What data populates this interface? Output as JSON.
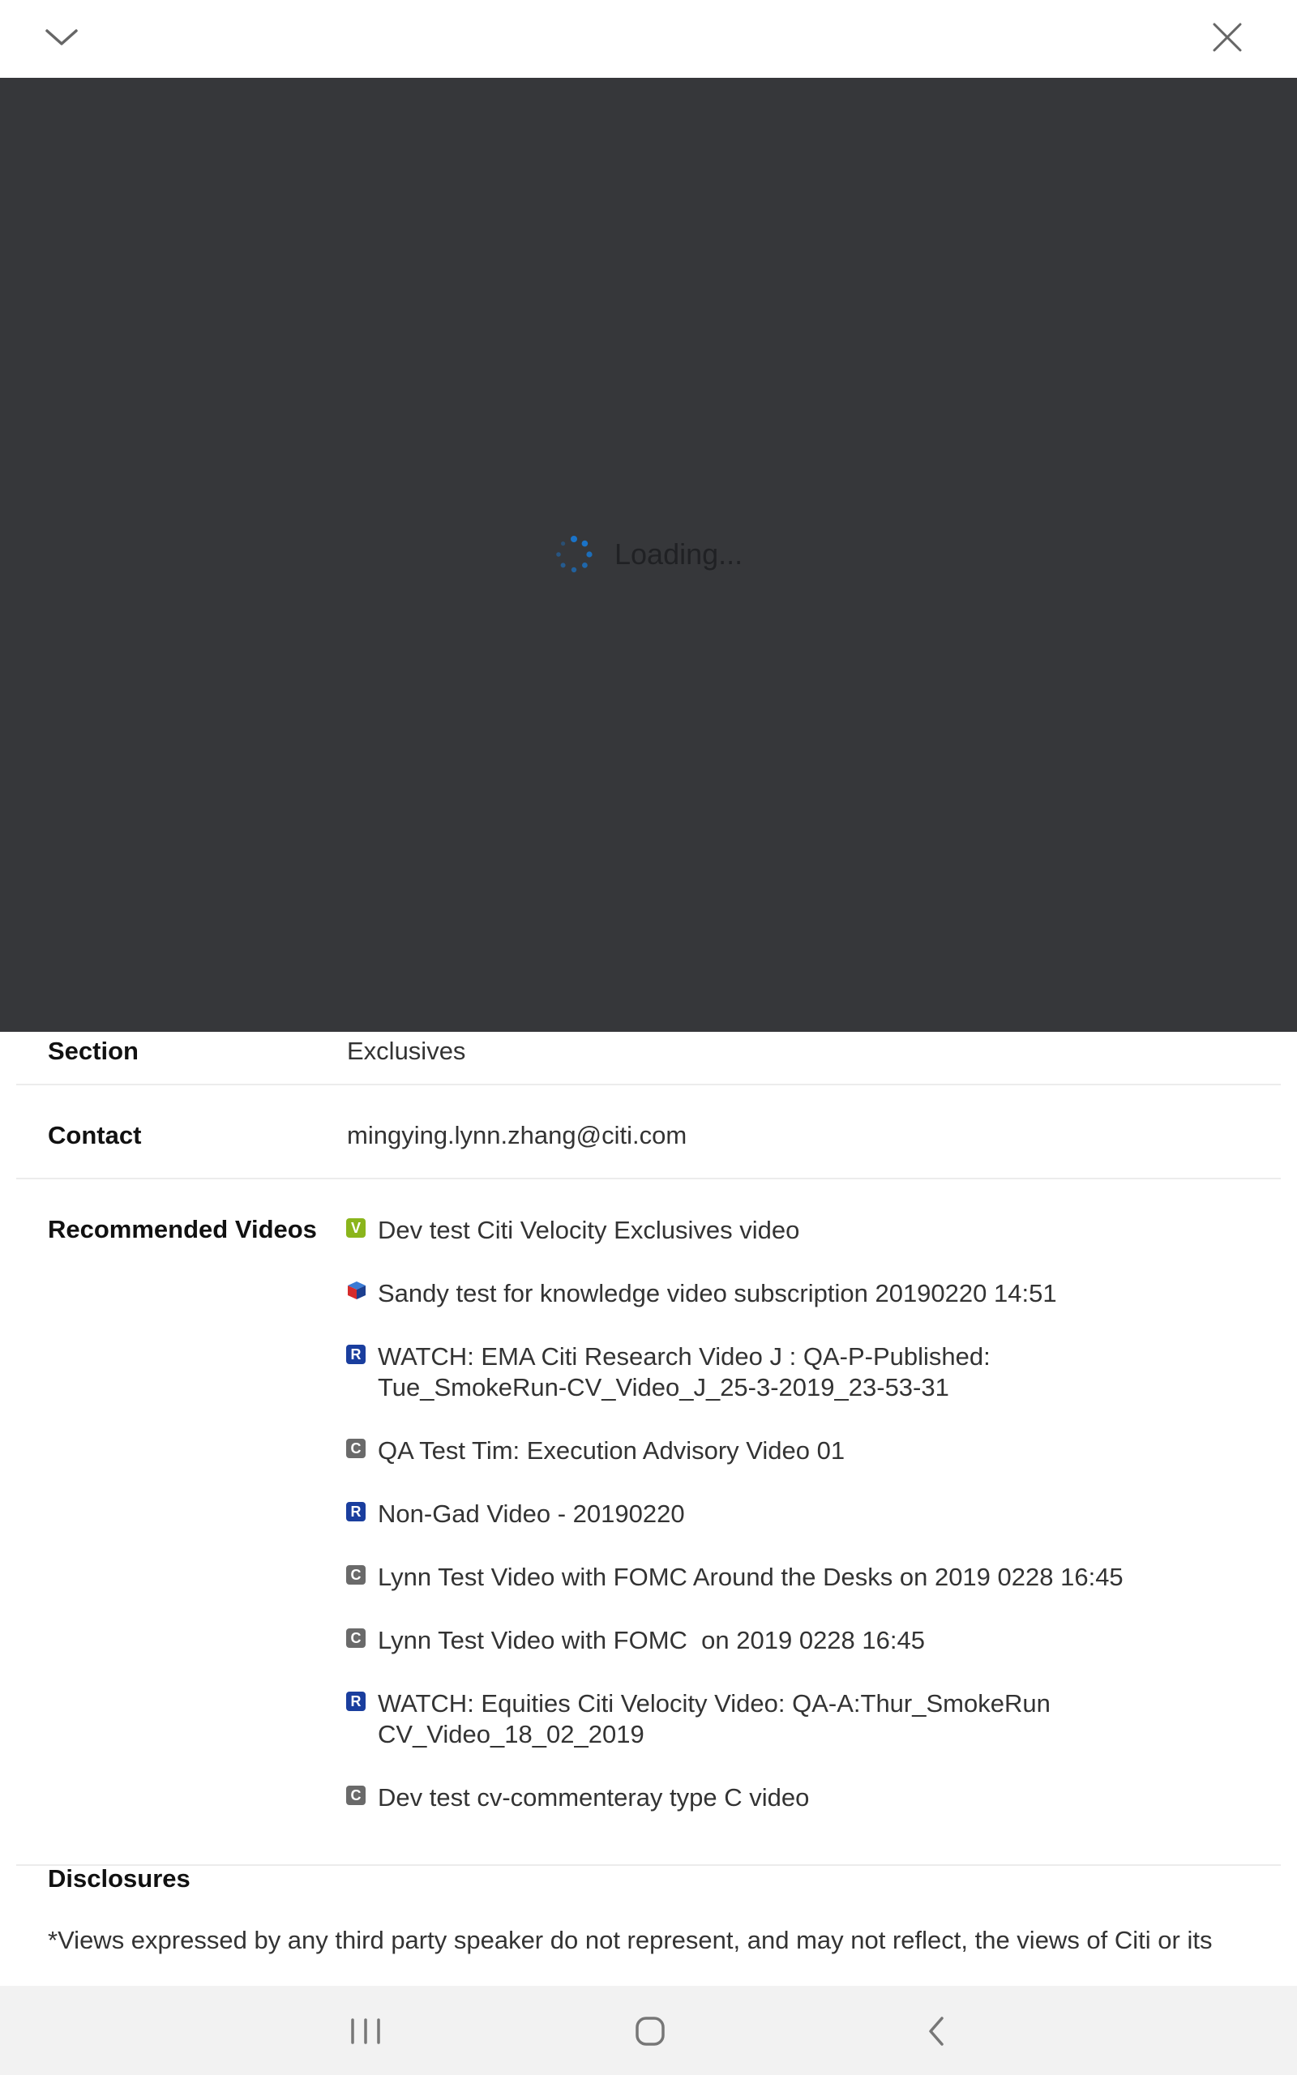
{
  "player": {
    "loading_text": "Loading..."
  },
  "details": {
    "section": {
      "label": "Section",
      "value": "Exclusives"
    },
    "contact": {
      "label": "Contact",
      "value": "mingying.lynn.zhang@citi.com"
    },
    "recommended": {
      "label": "Recommended Videos",
      "items": [
        {
          "badge": "V",
          "type": "v",
          "title": "Dev test Citi Velocity Exclusives video"
        },
        {
          "badge": "",
          "type": "cube",
          "title": "Sandy test for knowledge video subscription 20190220 14:51"
        },
        {
          "badge": "R",
          "type": "r",
          "title": "WATCH: EMA Citi Research Video J : QA-P-Published:\nTue_SmokeRun-CV_Video_J_25-3-2019_23-53-31"
        },
        {
          "badge": "C",
          "type": "c",
          "title": "QA Test Tim: Execution Advisory Video 01"
        },
        {
          "badge": "R",
          "type": "r",
          "title": "Non-Gad Video - 20190220"
        },
        {
          "badge": "C",
          "type": "c",
          "title": "Lynn Test Video with FOMC Around the Desks on 2019 0228 16:45"
        },
        {
          "badge": "C",
          "type": "c",
          "title": "Lynn Test Video with FOMC  on 2019 0228 16:45"
        },
        {
          "badge": "R",
          "type": "r",
          "title": "WATCH: Equities Citi Velocity Video: QA-A:Thur_SmokeRun\nCV_Video_18_02_2019"
        },
        {
          "badge": "C",
          "type": "c",
          "title": "Dev test cv-commenteray type C video"
        }
      ]
    },
    "disclosures": {
      "label": "Disclosures",
      "text": "*Views expressed by any third party speaker do not represent, and may not reflect, the views of Citi or its"
    }
  },
  "colors": {
    "player_bg": "#36373a",
    "spinner": "#1a73c8",
    "badge_v": "#8ab51c",
    "badge_r": "#1a3e9e",
    "badge_c": "#6a6a6a"
  }
}
